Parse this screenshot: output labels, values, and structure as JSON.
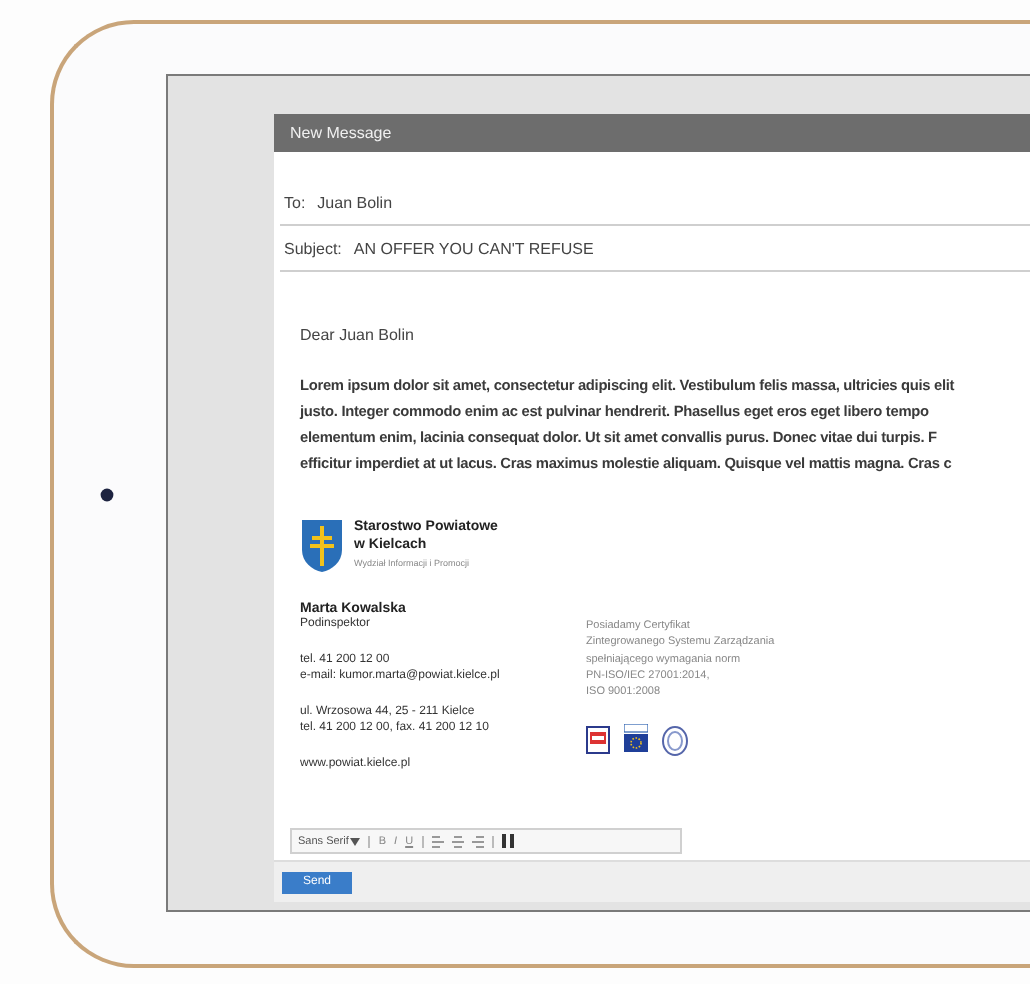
{
  "window": {
    "title": "New Message"
  },
  "to": {
    "label": "To:",
    "value": "Juan Bolin"
  },
  "subject": {
    "label": "Subject:",
    "value": "AN OFFER YOU CAN'T REFUSE"
  },
  "body": {
    "greeting": "Dear Juan Bolin",
    "lines": [
      "Lorem ipsum dolor sit amet, consectetur adipiscing elit. Vestibulum felis massa, ultricies quis elit",
      "justo. Integer commodo enim ac est pulvinar hendrerit. Phasellus eget eros eget libero tempo",
      "elementum enim, lacinia consequat dolor. Ut sit amet convallis purus. Donec vitae dui turpis. F",
      "efficitur imperdiet at ut lacus. Cras maximus molestie aliquam. Quisque vel mattis magna. Cras c"
    ]
  },
  "signature": {
    "organization": [
      "Starostwo Powiatowe",
      "w Kielcach"
    ],
    "department": "Wydział Informacji i Promocji",
    "name": "Marta Kowalska",
    "position": "Podinspektor",
    "contact_groups": [
      [
        "tel. 41 200 12 00",
        "e-mail: kumor.marta@powiat.kielce.pl"
      ],
      [
        "ul. Wrzosowa 44, 25 - 211 Kielce",
        "tel. 41 200 12 00, fax. 41 200 12 10"
      ],
      [
        "www.powiat.kielce.pl"
      ]
    ],
    "certificate_lines": [
      "Posiadamy Certyfikat",
      "Zintegrowanego Systemu Zarządzania",
      "spełniającego wymagania norm",
      "PN-ISO/IEC 27001:2014,",
      "ISO 9001:2008"
    ]
  },
  "toolbar": [
    {
      "kind": "font",
      "label": "Sans Serif"
    },
    {
      "kind": "separator"
    },
    {
      "kind": "bold",
      "label": "B"
    },
    {
      "kind": "italic",
      "label": "I"
    },
    {
      "kind": "underline",
      "label": "U"
    },
    {
      "kind": "separator"
    },
    {
      "kind": "align_left"
    },
    {
      "kind": "align_center"
    },
    {
      "kind": "align_right"
    },
    {
      "kind": "separator"
    },
    {
      "kind": "quote"
    }
  ],
  "buttons": [
    "Send"
  ]
}
